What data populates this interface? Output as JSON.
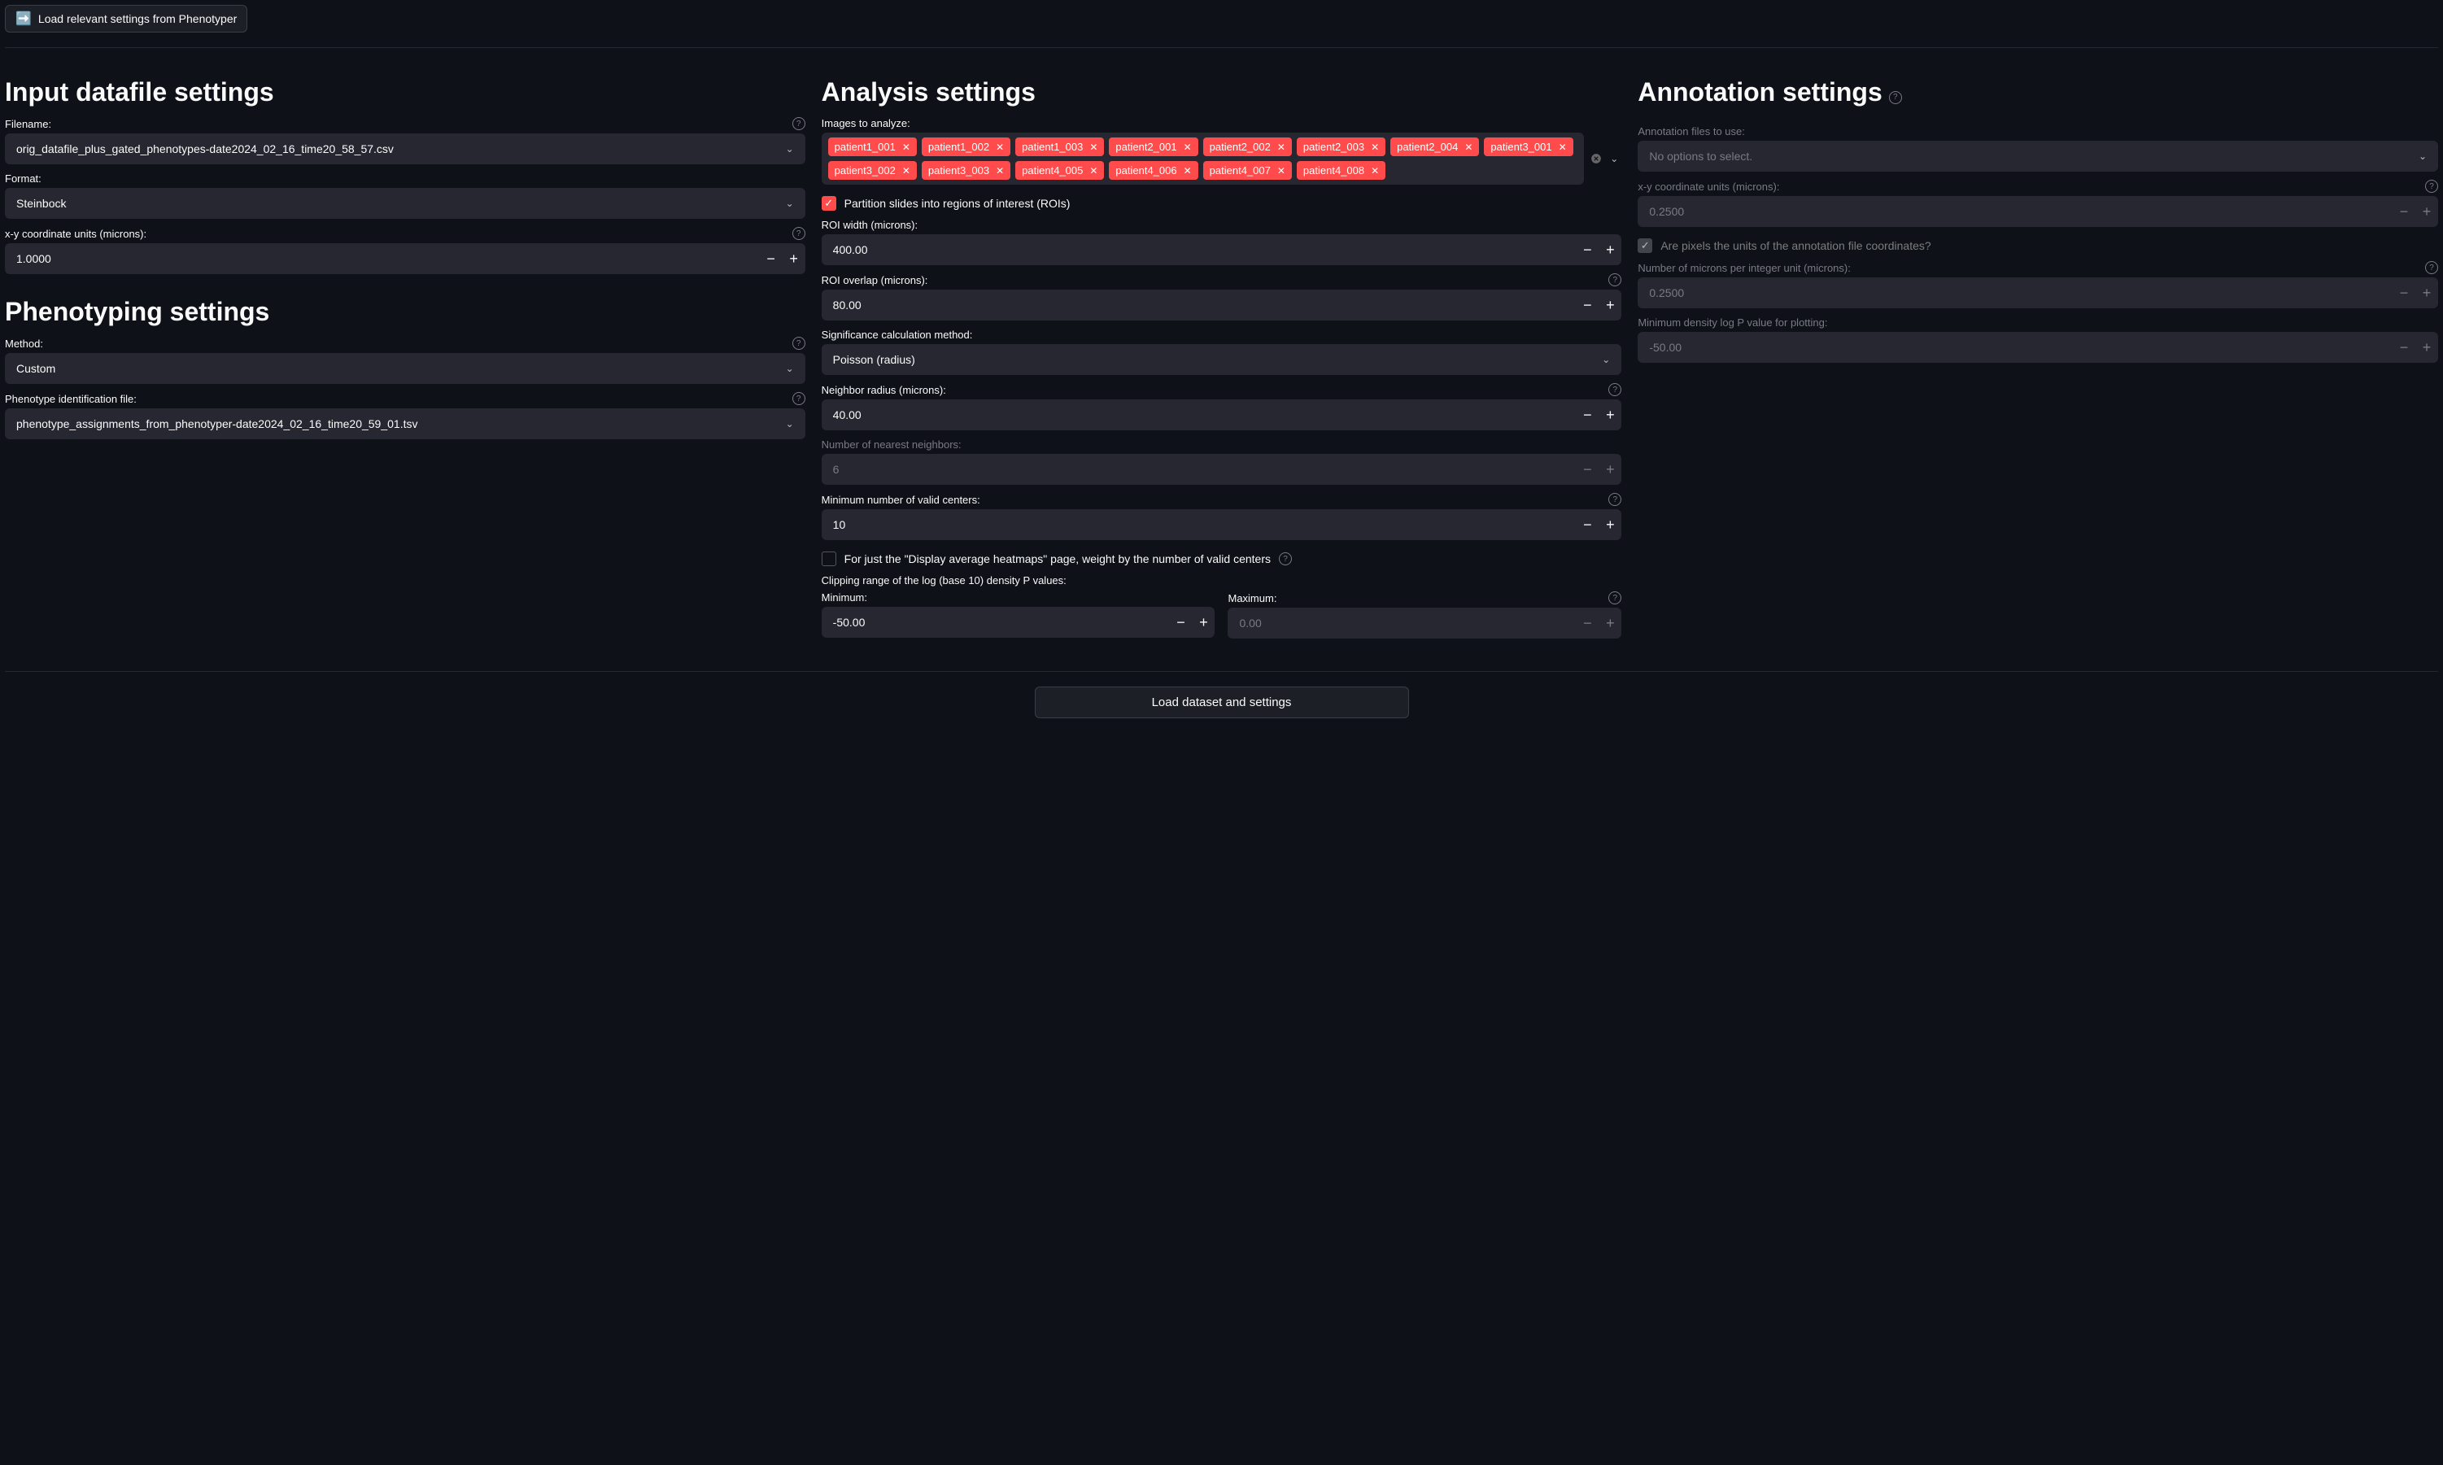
{
  "topbar": {
    "load_button": "Load relevant settings from Phenotyper"
  },
  "col1": {
    "input_title": "Input datafile settings",
    "filename_label": "Filename:",
    "filename_value": "orig_datafile_plus_gated_phenotypes-date2024_02_16_time20_58_57.csv",
    "format_label": "Format:",
    "format_value": "Steinbock",
    "xy_label": "x-y coordinate units (microns):",
    "xy_value": "1.0000",
    "pheno_title": "Phenotyping settings",
    "method_label": "Method:",
    "method_value": "Custom",
    "phenofile_label": "Phenotype identification file:",
    "phenofile_value": "phenotype_assignments_from_phenotyper-date2024_02_16_time20_59_01.tsv"
  },
  "col2": {
    "title": "Analysis settings",
    "images_label": "Images to analyze:",
    "images": [
      "patient1_001",
      "patient1_002",
      "patient1_003",
      "patient2_001",
      "patient2_002",
      "patient2_003",
      "patient2_004",
      "patient3_001",
      "patient3_002",
      "patient3_003",
      "patient4_005",
      "patient4_006",
      "patient4_007",
      "patient4_008"
    ],
    "partition_label": "Partition slides into regions of interest (ROIs)",
    "roi_width_label": "ROI width (microns):",
    "roi_width_value": "400.00",
    "roi_overlap_label": "ROI overlap (microns):",
    "roi_overlap_value": "80.00",
    "sigcalc_label": "Significance calculation method:",
    "sigcalc_value": "Poisson (radius)",
    "neighbor_label": "Neighbor radius (microns):",
    "neighbor_value": "40.00",
    "nn_label": "Number of nearest neighbors:",
    "nn_value": "6",
    "minvalid_label": "Minimum number of valid centers:",
    "minvalid_value": "10",
    "weight_label": "For just the \"Display average heatmaps\" page, weight by the number of valid centers",
    "clip_label": "Clipping range of the log (base 10) density P values:",
    "min_label": "Minimum:",
    "min_value": "-50.00",
    "max_label": "Maximum:",
    "max_value": "0.00"
  },
  "col3": {
    "title": "Annotation settings",
    "annofiles_label": "Annotation files to use:",
    "annofiles_value": "No options to select.",
    "xy_label": "x-y coordinate units (microns):",
    "xy_value": "0.2500",
    "pixel_label": "Are pixels the units of the annotation file coordinates?",
    "microns_label": "Number of microns per integer unit (microns):",
    "microns_value": "0.2500",
    "mindens_label": "Minimum density log P value for plotting:",
    "mindens_value": "-50.00"
  },
  "footer": {
    "load_dataset": "Load dataset and settings"
  }
}
